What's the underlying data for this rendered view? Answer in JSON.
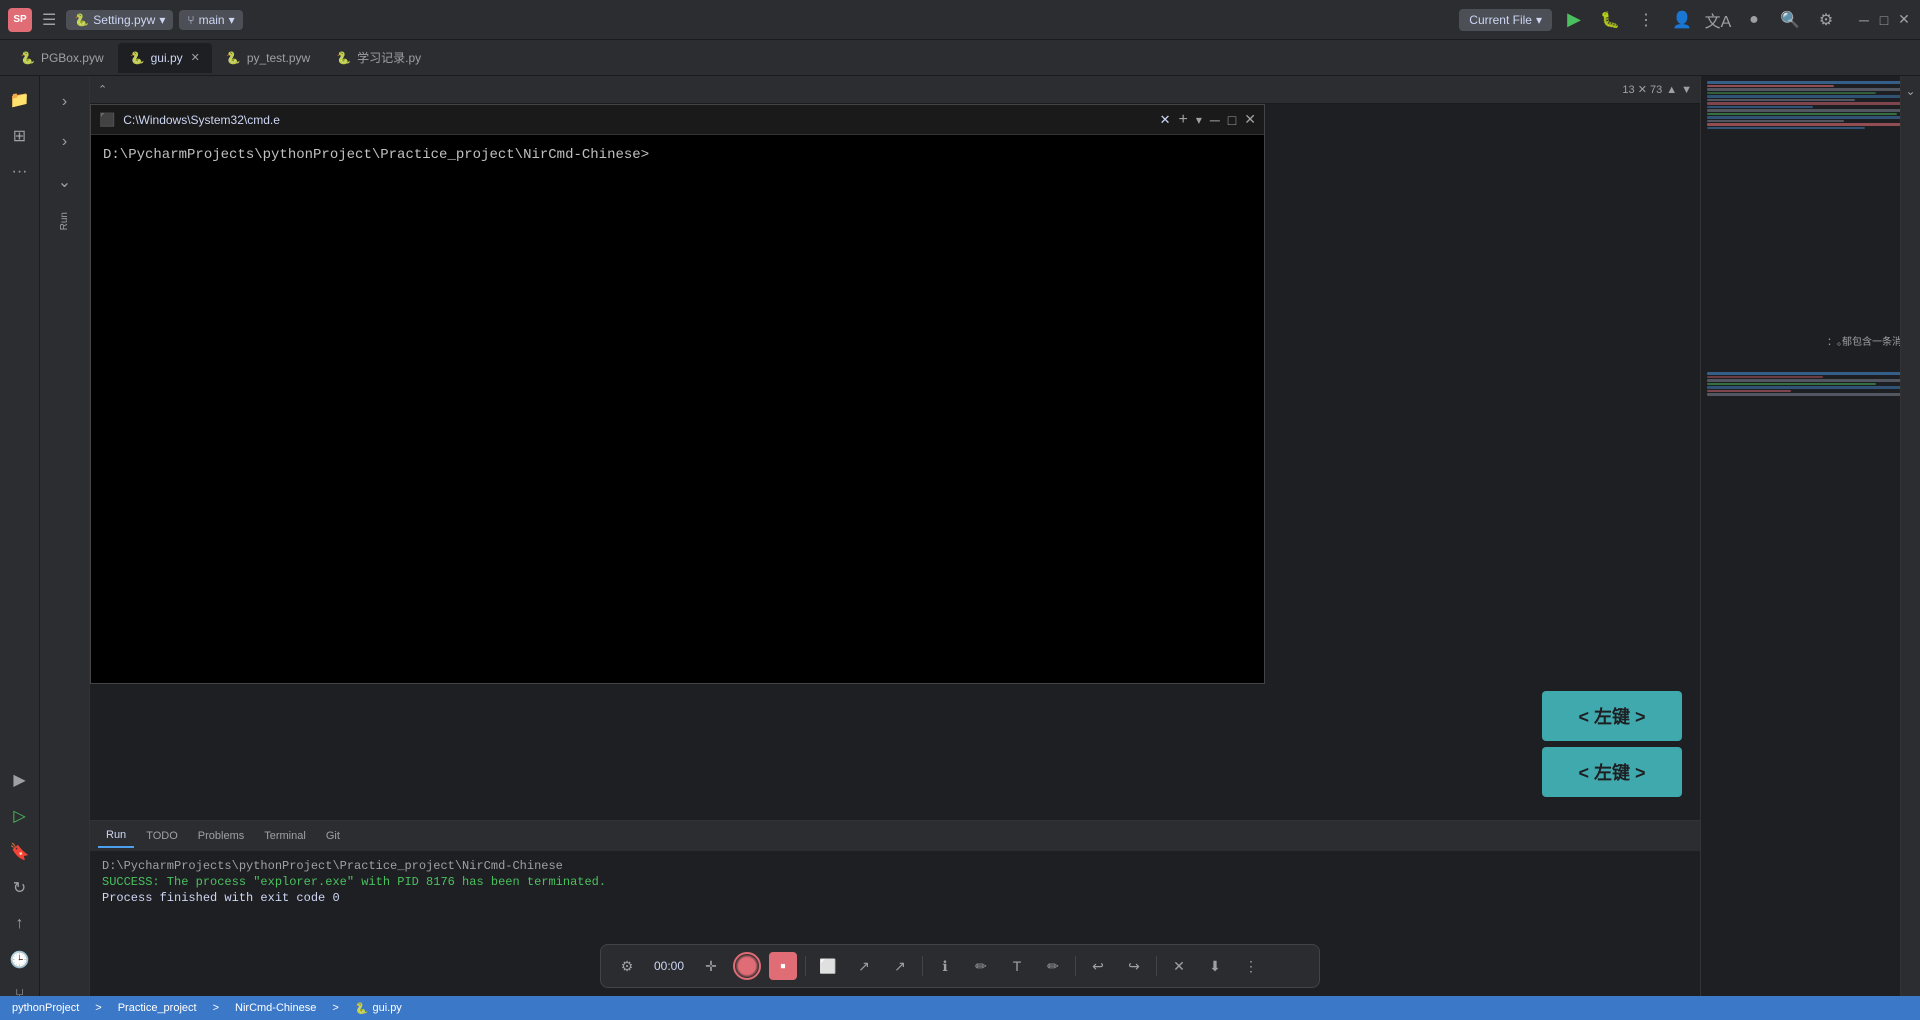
{
  "topbar": {
    "app_icon_label": "SP",
    "file_name": "Setting.pyw",
    "dropdown_arrow": "▾",
    "branch_icon": "⑂",
    "branch_name": "main",
    "current_file_label": "Current File",
    "run_icon": "▶",
    "debug_icon": "🐛",
    "more_icon": "⋮",
    "profile_icon": "👤",
    "translate_icon": "A文",
    "avatar_icon": "●",
    "search_icon": "🔍",
    "settings_icon": "⚙",
    "minimize_label": "─",
    "maximize_label": "□",
    "close_label": "✕"
  },
  "tabs": [
    {
      "id": "pgbox",
      "label": "PGBox.pyw",
      "icon": "🐍",
      "active": false,
      "closable": false
    },
    {
      "id": "gui",
      "label": "gui.py",
      "icon": "🐍",
      "active": true,
      "closable": true
    },
    {
      "id": "pytest",
      "label": "py_test.pyw",
      "icon": "🐍",
      "active": false,
      "closable": false
    },
    {
      "id": "xuexi",
      "label": "学习记录.py",
      "icon": "🐍",
      "active": false,
      "closable": false
    }
  ],
  "editor_header": {
    "line_col": "13  73",
    "chevron_up": "⌃",
    "chevron_down": "⌄"
  },
  "cmd_window": {
    "title": "C:\\Windows\\System32\\cmd.e",
    "close_icon": "✕",
    "plus_icon": "+",
    "chevron": "▾",
    "min_label": "─",
    "max_label": "□",
    "close_label": "✕",
    "prompt_line": "D:\\PycharmProjects\\pythonProject\\Practice_project\\NirCmd-Chinese>"
  },
  "bottom_panel": {
    "tabs": [
      "Run",
      "TODO",
      "Problems",
      "Terminal",
      "Git"
    ],
    "active_tab": "Run",
    "lines": [
      {
        "type": "path",
        "text": "D:\\PycharmProjects\\pythonProject\\Practice_project\\NirCmd-Chinese"
      },
      {
        "type": "success",
        "text": "SUCCESS: The process \"explorer.exe\" with PID 8176 has been terminated."
      },
      {
        "type": "normal",
        "text": "Process finished with exit code 0"
      }
    ]
  },
  "run_panel": {
    "label": "Run"
  },
  "overlay_buttons": [
    {
      "id": "zuojian1",
      "label": "< 左键 >"
    },
    {
      "id": "zuojian2",
      "label": "< 左键 >"
    }
  ],
  "bottom_toolbar": {
    "settings_icon": "⚙",
    "time": "00:00",
    "move_icon": "✛",
    "record_active": true,
    "stop_icon": "⏹",
    "action1": "⬜",
    "action2": "↗",
    "action3": "↗",
    "info_icon": "ℹ",
    "edit_icon": "✏",
    "text_icon": "T",
    "draw_icon": "✏",
    "undo_icon": "↩",
    "redo_icon": "↪",
    "close_icon": "✕",
    "download_icon": "⬇",
    "more_icon": "⋮"
  },
  "status_bar": {
    "project": "pythonProject",
    "separator1": ">",
    "practice": "Practice_project",
    "separator2": ">",
    "nircmd": "NirCmd-Chinese",
    "separator3": ">",
    "file": "gui.py",
    "file_icon": "🐍"
  }
}
